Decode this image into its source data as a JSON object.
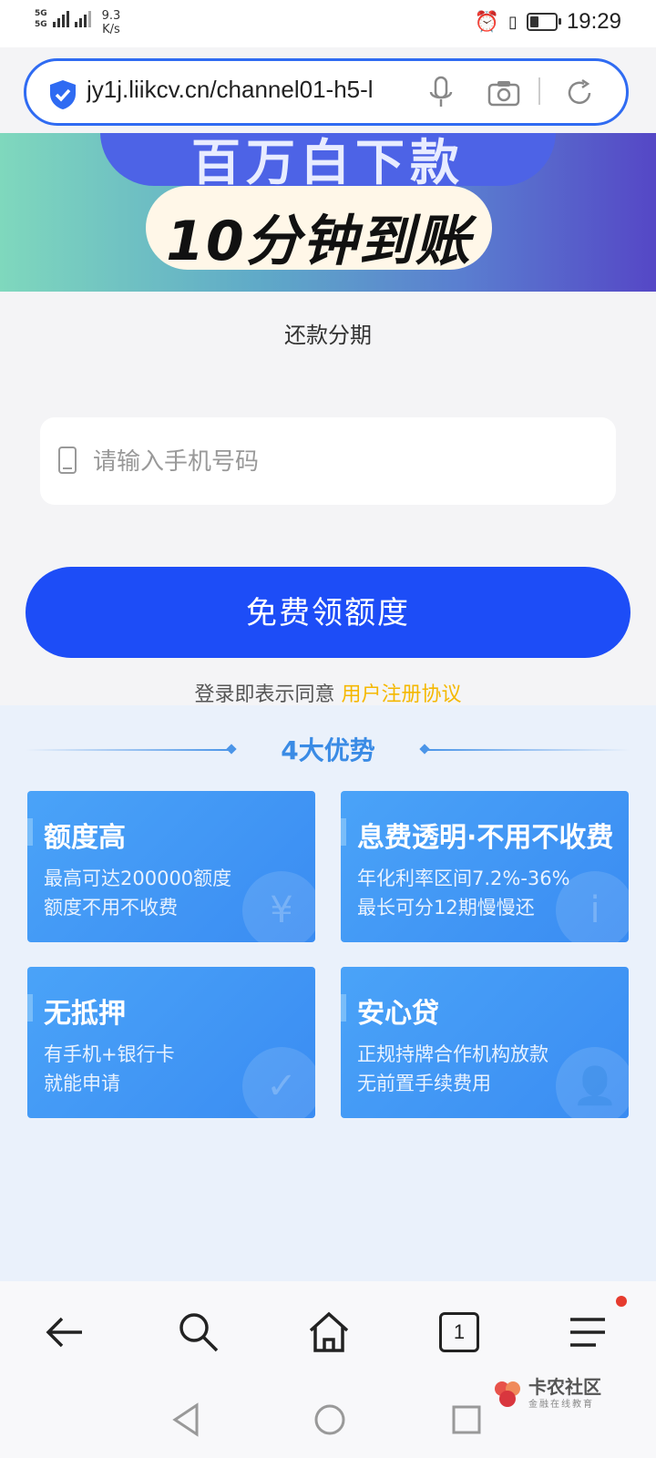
{
  "status_bar": {
    "sim1": "5G",
    "sim2": "5G",
    "net_speed_value": "9.3",
    "net_speed_unit": "K/s",
    "time": "19:29",
    "battery_level": 0.35
  },
  "browser": {
    "url": "jy1j.liikcv.cn/channel01-h5-l"
  },
  "banner": {
    "top_text": "百万白下款",
    "main_text": "10分钟到账"
  },
  "page": {
    "section_title": "还款分期",
    "phone_placeholder": "请输入手机号码",
    "cta_label": "免费领额度",
    "agree_prefix": "登录即表示同意",
    "agree_link": "用户注册协议"
  },
  "advantages": {
    "title": "4大优势",
    "cards": [
      {
        "title": "额度高",
        "line1": "最高可达200000额度",
        "line2": "额度不用不收费",
        "icon": "yuan-icon"
      },
      {
        "title": "息费透明·不用不收费",
        "line1": "年化利率区间7.2%-36%",
        "line2": "最长可分12期慢慢还",
        "icon": "info-icon"
      },
      {
        "title": "无抵押",
        "line1": "有手机+银行卡",
        "line2": "就能申请",
        "icon": "shield-check-icon"
      },
      {
        "title": "安心贷",
        "line1": "正规持牌合作机构放款",
        "line2": "无前置手续费用",
        "icon": "user-icon"
      }
    ]
  },
  "bottom_nav": {
    "tab_count": "1"
  },
  "watermark": {
    "name": "卡农社区",
    "tagline": "金融在线教育"
  },
  "colors": {
    "primary": "#1d4df7",
    "link": "#f5b800",
    "card": "#3a8cf2"
  }
}
